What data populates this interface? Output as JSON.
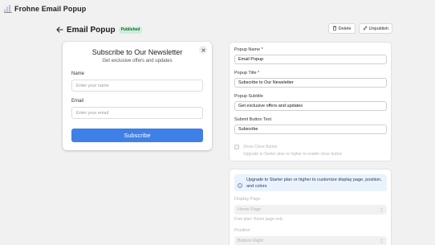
{
  "app": {
    "title": "Frohne Email Popup",
    "icon": "bar-chart-icon"
  },
  "header": {
    "back_icon": "arrow-left-icon",
    "title": "Email Popup",
    "status_badge": "Published",
    "actions": {
      "delete_label": "Delete",
      "unpublish_label": "Unpublish"
    }
  },
  "preview": {
    "title": "Subscribe to Our Newsletter",
    "subtitle": "Get exclusive offers and updates",
    "name_label": "Name",
    "name_placeholder": "Enter your name",
    "email_label": "Email",
    "email_placeholder": "Enter your email",
    "submit_label": "Subscribe"
  },
  "settings": {
    "popup_name": {
      "label": "Popup Name *",
      "value": "Email Popup"
    },
    "popup_title": {
      "label": "Popup Title *",
      "value": "Subscribe to Our Newsletter"
    },
    "popup_subtitle": {
      "label": "Popup Subtitle",
      "value": "Get exclusive offers and updates"
    },
    "submit_text": {
      "label": "Submit Button Text",
      "value": "Subscribe"
    },
    "show_close": {
      "label": "Show Close Button",
      "help": "Upgrade to Starter plan or higher to enable close button",
      "checked": false
    }
  },
  "display": {
    "info": "Upgrade to Starter plan or higher to customize display page, position, and colors",
    "display_page": {
      "label": "Display Page",
      "value": "Home Page",
      "help": "Free plan: Home page only"
    },
    "position": {
      "label": "Position",
      "value": "Bottom Right"
    }
  },
  "colors": {
    "accent": "#3f7fe8",
    "badge_bg": "#cdeed9",
    "badge_text": "#146c3a",
    "info_bg": "#eaf2fd"
  }
}
